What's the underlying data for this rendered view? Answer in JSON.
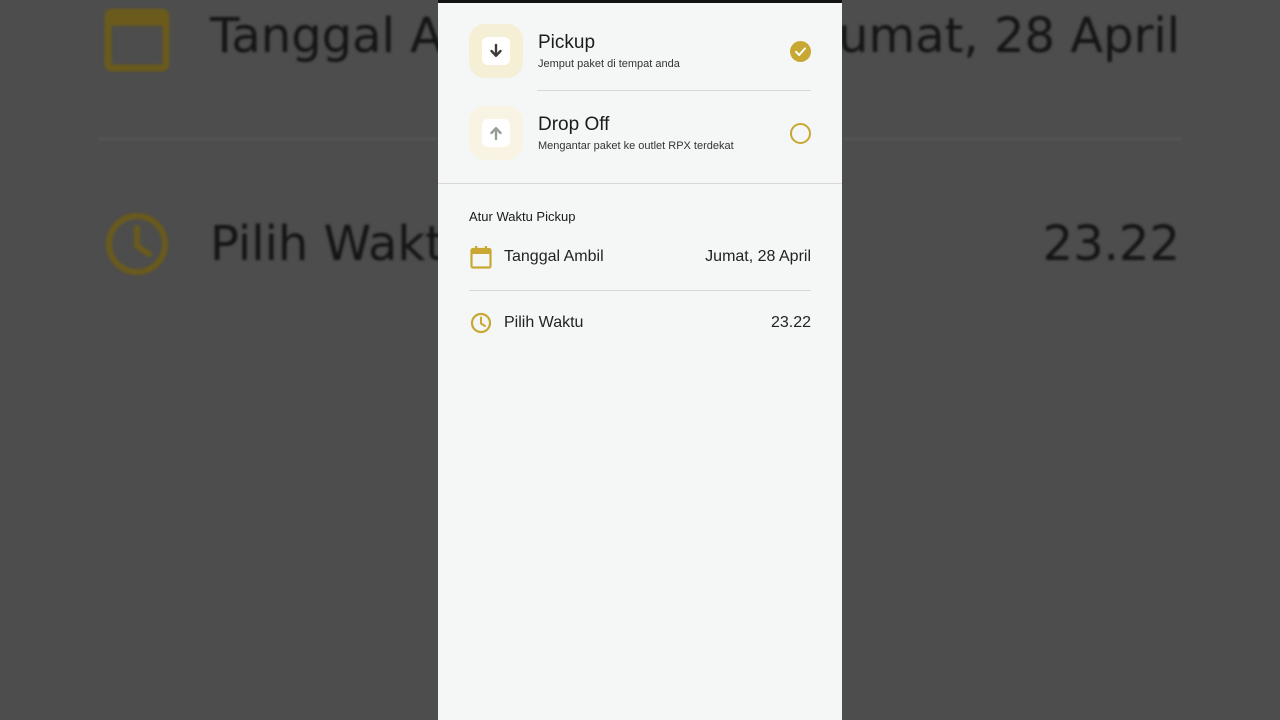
{
  "background": {
    "date_label": "Tanggal A",
    "date_value": "umat, 28 April",
    "time_label": "Pilih Waktu",
    "time_value": "23.22"
  },
  "delivery_options": [
    {
      "title": "Pickup",
      "subtitle": "Jemput paket di tempat anda",
      "icon": "arrow-down-icon",
      "selected": true
    },
    {
      "title": "Drop Off",
      "subtitle": "Mengantar paket ke outlet RPX terdekat",
      "icon": "arrow-up-icon",
      "selected": false
    }
  ],
  "schedule": {
    "section_title": "Atur Waktu Pickup",
    "date": {
      "label": "Tanggal Ambil",
      "value": "Jumat, 28 April",
      "icon": "calendar-icon"
    },
    "time": {
      "label": "Pilih Waktu",
      "value": "23.22",
      "icon": "clock-icon"
    }
  },
  "colors": {
    "accent": "#c8a832",
    "icon_bg": "#f5efd6",
    "screen_bg": "#f4f7f6"
  }
}
